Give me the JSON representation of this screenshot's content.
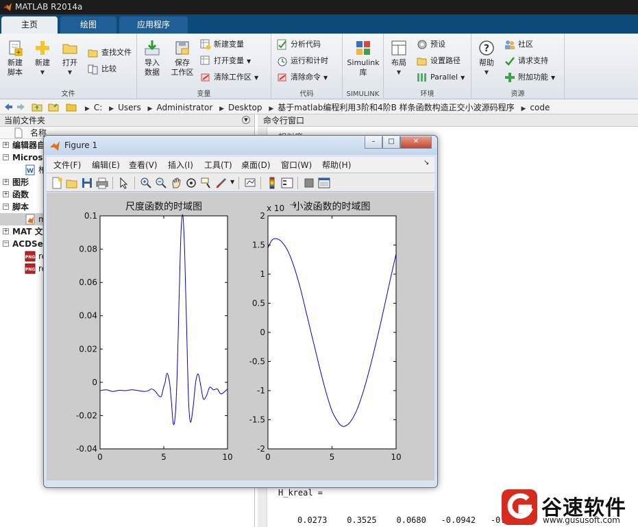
{
  "window": {
    "title": "MATLAB R2014a"
  },
  "tabs": [
    {
      "label": "主页",
      "active": true
    },
    {
      "label": "绘图",
      "active": false
    },
    {
      "label": "应用程序",
      "active": false
    }
  ],
  "ribbon": {
    "file": {
      "label": "文件",
      "new_script": "新建\n脚本",
      "new": "新建",
      "open": "打开",
      "find_files": "查找文件",
      "compare": "比较"
    },
    "variable": {
      "label": "变量",
      "import_data": "导入\n数据",
      "save_workspace": "保存\n工作区",
      "new_variable": "新建变量",
      "open_variable": "打开变量",
      "clear_workspace": "清除工作区"
    },
    "code": {
      "label": "代码",
      "analyze_code": "分析代码",
      "run_and_time": "运行和计时",
      "clear_commands": "清除命令"
    },
    "simulink": {
      "label": "SIMULINK",
      "library": "Simulink\n库"
    },
    "environment": {
      "label": "环境",
      "layout": "布局",
      "preferences": "预设",
      "set_path": "设置路径",
      "parallel": "Parallel"
    },
    "resources": {
      "label": "资源",
      "help": "帮助",
      "community": "社区",
      "request_support": "请求支持",
      "add_ons": "附加功能"
    }
  },
  "address": {
    "crumbs": [
      "C:",
      "Users",
      "Administrator",
      "Desktop",
      "基于matlab编程利用3阶和4阶B 样条函数构造正交小波源码程序",
      "code"
    ]
  },
  "left_panel": {
    "title": "当前文件夹",
    "column_name": "名称",
    "tree": [
      {
        "label": "编辑器自",
        "kind": "section",
        "expanded": false
      },
      {
        "label": "Microso",
        "kind": "section",
        "expanded": true
      },
      {
        "label": "栯",
        "kind": "file",
        "icon": "word-icon"
      },
      {
        "label": "图形",
        "kind": "section",
        "expanded": false
      },
      {
        "label": "函数",
        "kind": "section",
        "expanded": false
      },
      {
        "label": "脚本",
        "kind": "section",
        "expanded": true
      },
      {
        "label": "m",
        "kind": "file",
        "icon": "matlab-script-icon",
        "selected": true
      },
      {
        "label": "MAT 文",
        "kind": "section",
        "expanded": false
      },
      {
        "label": "ACDSee",
        "kind": "section",
        "expanded": true
      },
      {
        "label": "re",
        "kind": "file",
        "icon": "png-icon"
      },
      {
        "label": "re",
        "kind": "file",
        "icon": "png-icon"
      }
    ]
  },
  "right_panel": {
    "title": "命令行窗口",
    "partial_top_text": "相似度",
    "h_kreal_label": "H_kreal =",
    "h_kreal_values": "0.0273    0.3525    0.0680   -0.0942   -0.01"
  },
  "figure": {
    "title": "Figure 1",
    "menus": [
      "文件(F)",
      "编辑(E)",
      "查看(V)",
      "插入(I)",
      "工具(T)",
      "桌面(D)",
      "窗口(W)",
      "帮助(H)"
    ],
    "toolbar_icons": [
      "new-figure-icon",
      "open-file-icon",
      "save-icon",
      "print-icon",
      "select-arrow-icon",
      "zoom-in-icon",
      "zoom-out-icon",
      "pan-icon",
      "rotate-icon",
      "data-cursor-icon",
      "brush-icon",
      "link-plot-icon",
      "colorbar-icon",
      "legend-icon",
      "hide-plot-tools-icon",
      "show-plot-tools-icon"
    ]
  },
  "chart_data": [
    {
      "type": "line",
      "title": "尺度函数的时域图",
      "xlabel": "",
      "ylabel": "",
      "xlim": [
        0,
        10
      ],
      "ylim": [
        -0.04,
        0.1
      ],
      "xticks": [
        0,
        5,
        10
      ],
      "yticks": [
        -0.04,
        -0.02,
        0,
        0.02,
        0.04,
        0.06,
        0.08,
        0.1
      ],
      "ytick_labels": [
        "-0.04",
        "-0.02",
        "0",
        "0.02",
        "0.04",
        "0.06",
        "0.08",
        "0.1"
      ],
      "color": "#0000cc",
      "x": [
        0,
        0.5,
        1.0,
        1.5,
        2.0,
        2.5,
        3.0,
        3.5,
        3.8,
        4.0,
        4.2,
        4.4,
        4.6,
        4.8,
        4.95,
        5.1,
        5.25,
        5.45,
        5.6,
        5.75,
        5.9,
        6.05,
        6.2,
        6.35,
        6.5,
        6.65,
        6.8,
        6.95,
        7.1,
        7.3,
        7.5,
        7.7,
        7.9,
        8.1,
        8.35,
        8.6,
        8.9,
        9.2,
        9.5,
        10
      ],
      "y": [
        -0.005,
        -0.0045,
        -0.0055,
        -0.0048,
        -0.005,
        -0.0045,
        -0.005,
        -0.0055,
        -0.005,
        -0.004,
        -0.0045,
        -0.006,
        -0.008,
        -0.0085,
        -0.004,
        0.0,
        0.0055,
        0.0,
        -0.012,
        -0.025,
        -0.02,
        0.005,
        0.05,
        0.09,
        0.1,
        0.075,
        0.03,
        -0.012,
        -0.024,
        -0.015,
        0.0,
        0.005,
        -0.002,
        -0.01,
        -0.008,
        -0.003,
        -0.0045,
        -0.004,
        -0.007,
        -0.004
      ]
    },
    {
      "type": "line",
      "title": "小波函数的时域图",
      "xlabel": "",
      "ylabel": "",
      "exponent_label": "x 10",
      "exponent": "-4",
      "xlim": [
        0,
        10
      ],
      "ylim": [
        -2,
        2
      ],
      "xticks": [
        0,
        5,
        10
      ],
      "yticks": [
        -2,
        -1.5,
        -1,
        -0.5,
        0,
        0.5,
        1,
        1.5,
        2
      ],
      "ytick_labels": [
        "-2",
        "-1.5",
        "-1",
        "-0.5",
        "0",
        "0.5",
        "1",
        "1.5",
        "2"
      ],
      "color": "#0000cc",
      "x": [
        0,
        0.3,
        0.6,
        1.0,
        1.5,
        2.0,
        2.5,
        3.0,
        3.5,
        4.0,
        4.5,
        5.0,
        5.5,
        5.8,
        6.0,
        6.3,
        6.6,
        7.0,
        7.5,
        8.0,
        8.5,
        9.0,
        9.5,
        10
      ],
      "y": [
        1.45,
        1.58,
        1.61,
        1.57,
        1.42,
        1.15,
        0.78,
        0.33,
        -0.12,
        -0.58,
        -1.0,
        -1.35,
        -1.55,
        -1.61,
        -1.61,
        -1.57,
        -1.48,
        -1.3,
        -0.97,
        -0.57,
        -0.12,
        0.36,
        0.86,
        1.35
      ]
    }
  ],
  "watermark": {
    "text": "谷速软件",
    "url": "www.gususoft.com"
  },
  "colors": {
    "tab_strip": "#0c4a7a",
    "plot_line": "#0000cc",
    "figure_bg": "#cccccc",
    "watermark_red": "#d62c1f"
  }
}
